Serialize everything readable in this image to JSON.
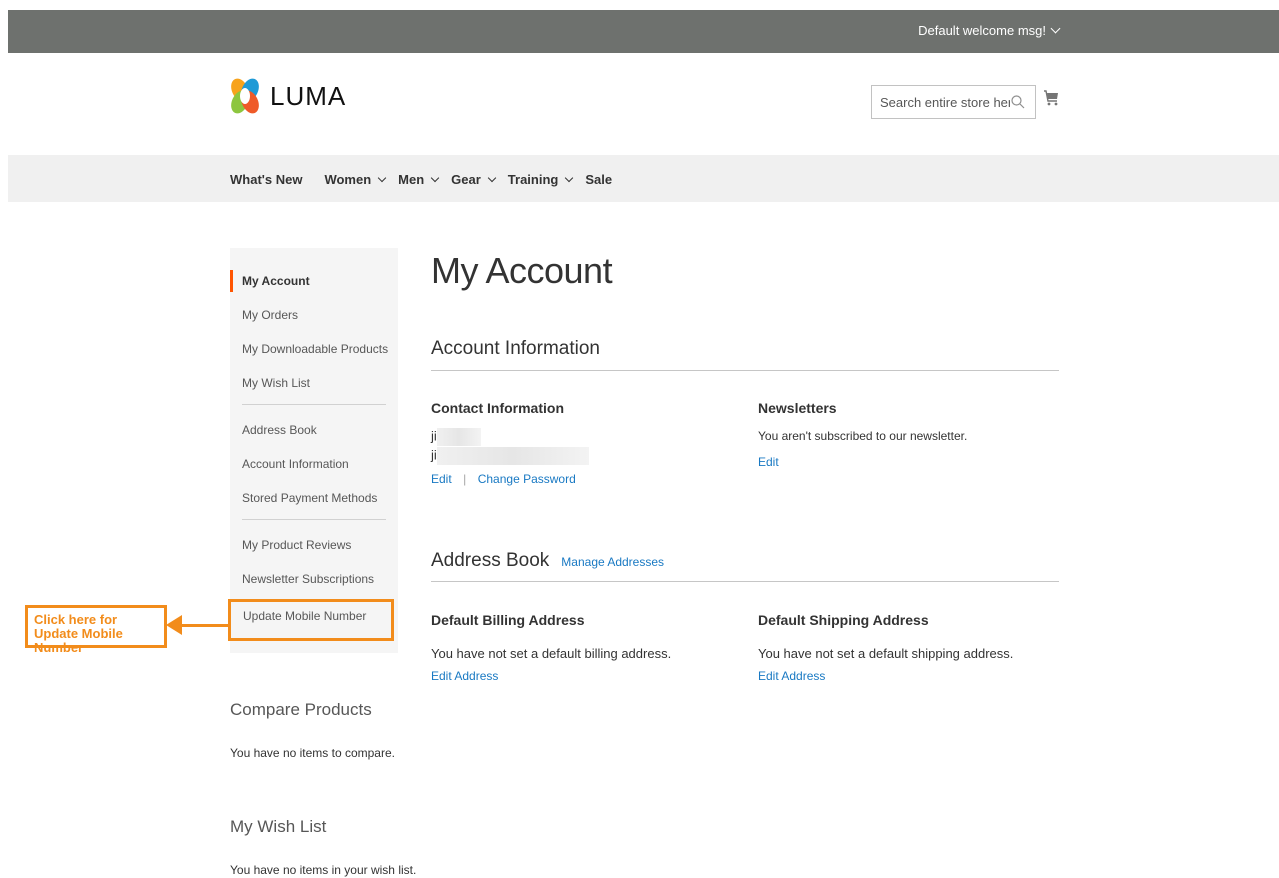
{
  "header": {
    "welcome_text": "Default welcome msg!",
    "logo_text": "LUMA",
    "search_placeholder": "Search entire store here..."
  },
  "nav": {
    "items": [
      "What's New",
      "Women",
      "Men",
      "Gear",
      "Training",
      "Sale"
    ]
  },
  "sidebar": {
    "items": [
      "My Account",
      "My Orders",
      "My Downloadable Products",
      "My Wish List",
      "Address Book",
      "Account Information",
      "Stored Payment Methods",
      "My Product Reviews",
      "Newsletter Subscriptions",
      "Update Mobile Number"
    ],
    "compare_title": "Compare Products",
    "compare_text": "You have no items to compare.",
    "wishlist_title": "My Wish List",
    "wishlist_text": "You have no items in your wish list."
  },
  "callout": {
    "text": "Click here for Update Mobile Number"
  },
  "main": {
    "page_title": "My Account",
    "account_info_title": "Account Information",
    "contact_title": "Contact Information",
    "contact_name_initial": "ji",
    "contact_email_initial": "ji",
    "edit_label": "Edit",
    "separator": "|",
    "change_password_label": "Change Password",
    "newsletters_title": "Newsletters",
    "newsletters_text": "You aren't subscribed to our newsletter.",
    "newsletters_edit_label": "Edit",
    "address_book_title": "Address Book",
    "manage_addresses_label": "Manage Addresses",
    "billing_title": "Default Billing Address",
    "billing_text": "You have not set a default billing address.",
    "billing_edit_label": "Edit Address",
    "shipping_title": "Default Shipping Address",
    "shipping_text": "You have not set a default shipping address.",
    "shipping_edit_label": "Edit Address"
  },
  "colors": {
    "topbar": "#6e716e",
    "accent_link": "#1979c3",
    "current_marker": "#ff5501",
    "callout": "#f28c1b"
  }
}
